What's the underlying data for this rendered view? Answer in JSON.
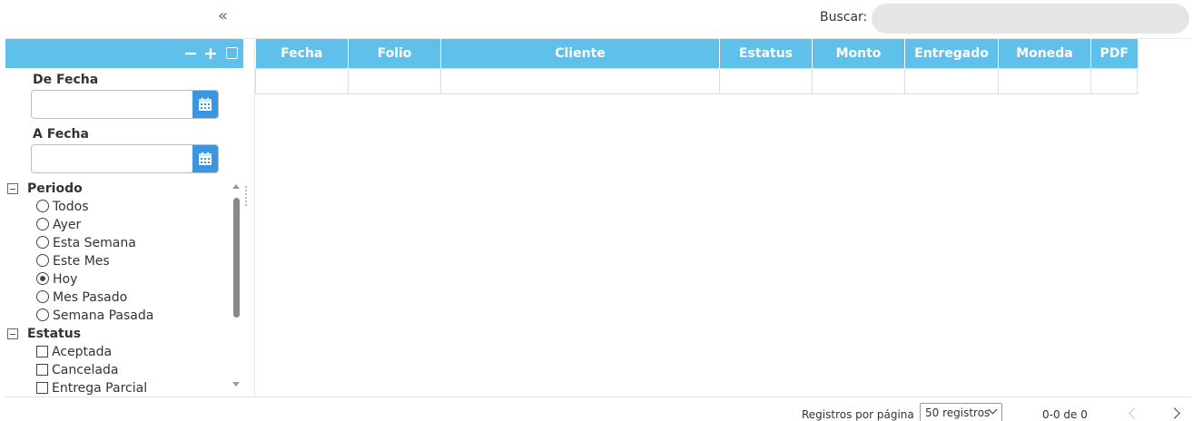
{
  "toolbar": {
    "collapse_icon": "double-chevron-left-icon",
    "collapse_glyph": "«"
  },
  "search": {
    "label": "Buscar:",
    "value": "",
    "placeholder": ""
  },
  "filters": {
    "tools": {
      "minus": "−",
      "plus": "+"
    },
    "from_label": "De Fecha",
    "to_label": "A Fecha",
    "from_value": "",
    "to_value": "",
    "calendar_icon": "calendar-icon",
    "periodo": {
      "label": "Periodo",
      "options": [
        {
          "label": "Todos",
          "selected": false
        },
        {
          "label": "Ayer",
          "selected": false
        },
        {
          "label": "Esta Semana",
          "selected": false
        },
        {
          "label": "Este Mes",
          "selected": false
        },
        {
          "label": "Hoy",
          "selected": true
        },
        {
          "label": "Mes Pasado",
          "selected": false
        },
        {
          "label": "Semana Pasada",
          "selected": false
        }
      ]
    },
    "estatus": {
      "label": "Estatus",
      "options": [
        {
          "label": "Aceptada",
          "checked": false
        },
        {
          "label": "Cancelada",
          "checked": false
        },
        {
          "label": "Entrega Parcial",
          "checked": false
        }
      ]
    }
  },
  "table": {
    "headers": [
      "Fecha",
      "Folio",
      "Cliente",
      "Estatus",
      "Monto",
      "Entregado",
      "Moneda",
      "PDF"
    ]
  },
  "pagination": {
    "per_page_label": "Registros por página",
    "per_page_value": "50 registros",
    "range": "0-0 de 0"
  },
  "colors": {
    "accent": "#5fc0ea",
    "calendar_button": "#3897e0",
    "search_bg": "#e6e6e6"
  }
}
